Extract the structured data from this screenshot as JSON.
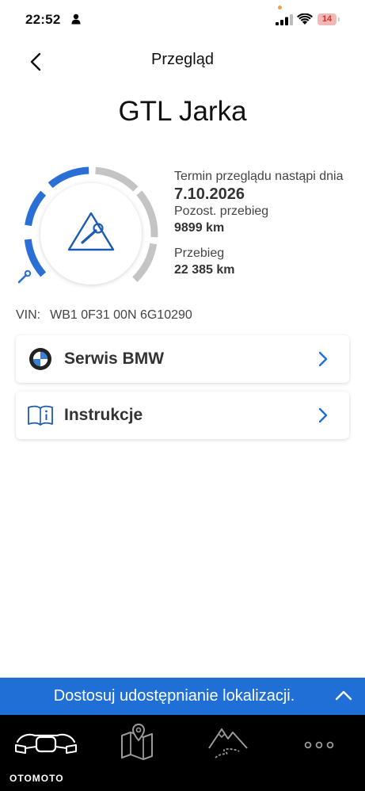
{
  "status_bar": {
    "time": "22:52",
    "battery": "14"
  },
  "nav": {
    "title": "Przegląd"
  },
  "vehicle": {
    "name": "GTL Jarka"
  },
  "service_info": {
    "due_label": "Termin przeglądu nastąpi dnia",
    "due_date": "7.10.2026",
    "remaining_label": "Pozost. przebieg",
    "remaining_value": "9899 km",
    "mileage_label": "Przebieg",
    "mileage_value": "22 385 km",
    "gauge_icon": "service-wrench-icon"
  },
  "vin": {
    "label": "VIN:",
    "value": "WB1 0F31 00N 6G10290"
  },
  "cards": [
    {
      "label": "Serwis BMW",
      "icon": "bmw-logo-icon"
    },
    {
      "label": "Instrukcje",
      "icon": "manual-book-icon"
    }
  ],
  "location_banner": {
    "text": "Dostosuj udostępnianie lokalizacji."
  },
  "tabs": [
    {
      "icon": "motorcycle-dashboard-icon",
      "active": true
    },
    {
      "icon": "map-icon",
      "active": false
    },
    {
      "icon": "route-mountains-icon",
      "active": false
    },
    {
      "icon": "more-icon",
      "active": false
    }
  ],
  "watermark": "OTOMOTO",
  "colors": {
    "accent": "#1f6fd6",
    "gauge_filled": "#2a6fd6",
    "gauge_empty": "#c4c4c4",
    "icon_blue": "#1c5bb4"
  }
}
